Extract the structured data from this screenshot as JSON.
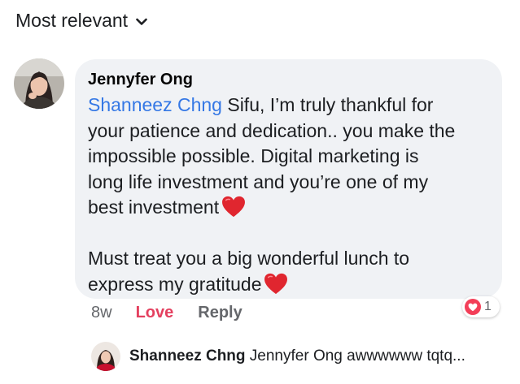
{
  "sort": {
    "label": "Most relevant"
  },
  "comment": {
    "author": "Jennyfer Ong",
    "mention": "Shanneez Chng",
    "line1_rest": " Sifu, I’m truly thankful for",
    "line2": "your patience and dedication.. you make the",
    "line3": "impossible possible. Digital marketing is",
    "line4": "long life investment and you’re one of my",
    "line5": "best investment",
    "line6": "Must treat you a big wonderful lunch to",
    "line7": "express my gratitude",
    "time": "8w",
    "love_label": "Love",
    "reply_label": "Reply",
    "reaction_count": "1"
  },
  "reply_preview": {
    "name": "Shanneez Chng",
    "text": "Jennyfer Ong awwwwww tqtq..."
  },
  "colors": {
    "mention": "#3578e5",
    "love": "#e4405f",
    "bubble": "#f0f2f5",
    "heart": "#e0262f"
  },
  "icons": {
    "sort_chevron": "chevron-down-icon",
    "heart": "heart-emoji-icon",
    "reaction": "love-reaction-icon"
  }
}
